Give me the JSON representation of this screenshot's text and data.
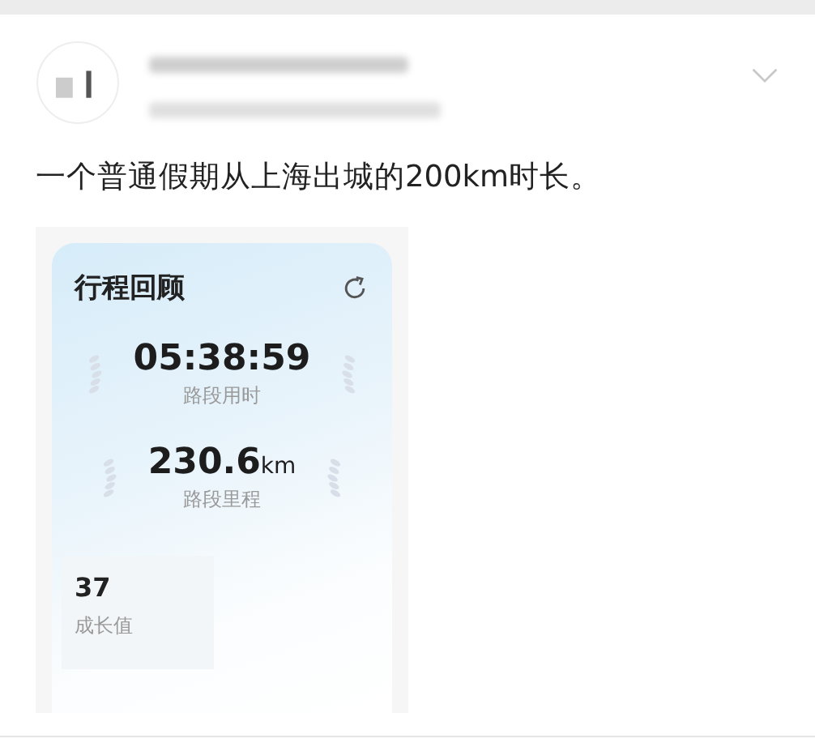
{
  "post": {
    "text": "一个普通假期从上海出城的200km时长。"
  },
  "trip_card": {
    "title": "行程回顾",
    "stats": [
      {
        "value": "05:38:59",
        "label": "路段用时"
      },
      {
        "value": "230.6",
        "unit": "km",
        "label": "路段里程"
      }
    ],
    "growth": {
      "value": "37",
      "label": "成长值"
    }
  }
}
